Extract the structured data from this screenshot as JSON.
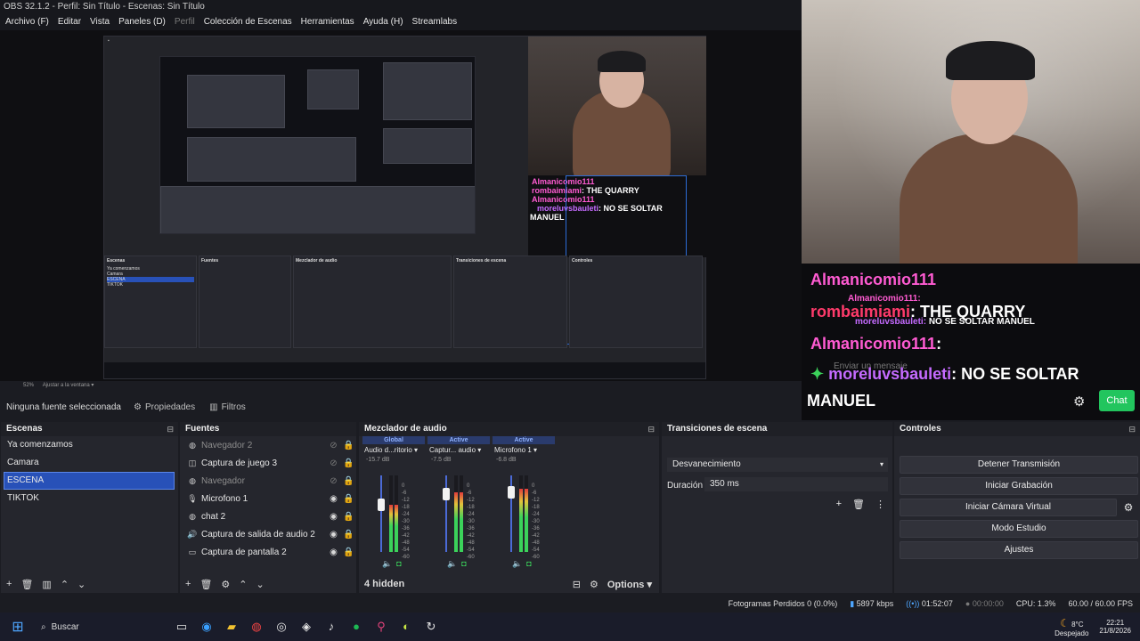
{
  "window": {
    "title": "OBS 32.1.2 - Perfil: Sin Título - Escenas: Sin Título"
  },
  "menu": [
    {
      "label": "Archivo (F)",
      "enabled": true
    },
    {
      "label": "Editar",
      "enabled": true
    },
    {
      "label": "Vista",
      "enabled": true
    },
    {
      "label": "Paneles (D)",
      "enabled": true
    },
    {
      "label": "Perfil",
      "enabled": false
    },
    {
      "label": "Colección de Escenas",
      "enabled": true
    },
    {
      "label": "Herramientas",
      "enabled": true
    },
    {
      "label": "Ayuda (H)",
      "enabled": true
    },
    {
      "label": "Streamlabs",
      "enabled": true
    }
  ],
  "chat_overlay": {
    "lines": [
      {
        "user": "Almanicomio111",
        "text": "",
        "user_color": "#ff5bd2"
      },
      {
        "user": "Almanicomio111:",
        "text": "",
        "user_color": "#ff5bd2"
      },
      {
        "user": "rombaimiami",
        "text": ": THE QUARRY",
        "user_color": "#ff3b6b"
      },
      {
        "user": "moreluvsbauleti:",
        "text": "NO SE SOLTAR MANUEL",
        "user_color": "#c56bff"
      },
      {
        "user": "Almanicomio111",
        "text": ":",
        "user_color": "#ff5bd2"
      },
      {
        "user": "moreluvsbauleti",
        "text": ": NO SE SOLTAR",
        "user_color": "#c56bff"
      }
    ],
    "manuel": "MANUEL",
    "input_placeholder": "Enviar un mensaje",
    "chat_button": "Chat"
  },
  "preview_strip": {
    "zoom": "52%",
    "fit": "Ajustar a la ventana"
  },
  "source_toolbar": {
    "message": "Ninguna fuente seleccionada",
    "properties": "Propiedades",
    "filters": "Filtros"
  },
  "scenes": {
    "title": "Escenas",
    "items": [
      {
        "label": "Ya comenzamos",
        "selected": false
      },
      {
        "label": "Camara",
        "selected": false
      },
      {
        "label": "ESCENA",
        "selected": true
      },
      {
        "label": "TIKTOK",
        "selected": false
      }
    ]
  },
  "sources": {
    "title": "Fuentes",
    "items": [
      {
        "label": "Navegador 2",
        "icon": "globe-icon",
        "visible": false,
        "muted": true
      },
      {
        "label": "Captura de juego 3",
        "icon": "gamepad-icon",
        "visible": false,
        "muted": false
      },
      {
        "label": "Navegador",
        "icon": "globe-icon",
        "visible": false,
        "muted": true
      },
      {
        "label": "Microfono 1",
        "icon": "mic-icon",
        "visible": true,
        "muted": false
      },
      {
        "label": "chat 2",
        "icon": "globe-icon",
        "visible": true,
        "muted": false
      },
      {
        "label": "Captura de salida de audio 2",
        "icon": "speaker-icon",
        "visible": true,
        "muted": false
      },
      {
        "label": "Captura de pantalla 2",
        "icon": "monitor-icon",
        "visible": true,
        "muted": false
      }
    ]
  },
  "mixer": {
    "title": "Mezclador de audio",
    "channels": [
      {
        "tag": "Global",
        "name": "Audio d...ritorio",
        "db": "-15.7 dB",
        "level": 0.62,
        "volume": 0.62
      },
      {
        "tag": "Active",
        "name": "Captur... audio",
        "db": "-7.5 dB",
        "level": 0.78,
        "volume": 0.76
      },
      {
        "tag": "Active",
        "name": "Microfono 1",
        "db": "-6.8 dB",
        "level": 0.82,
        "volume": 0.78
      }
    ],
    "scale": [
      "0",
      "-6",
      "-12",
      "-18",
      "-24",
      "-30",
      "-36",
      "-42",
      "-48",
      "-54",
      "-60"
    ],
    "hidden": "4 hidden",
    "options": "Options"
  },
  "transitions": {
    "title": "Transiciones de escena",
    "selected": "Desvanecimiento",
    "duration_label": "Duración",
    "duration_value": "350 ms"
  },
  "controls": {
    "title": "Controles",
    "buttons": [
      "Detener Transmisión",
      "Iniciar Grabación",
      "Iniciar Cámara Virtual",
      "Modo Estudio",
      "Ajustes"
    ]
  },
  "status": {
    "dropped": "Fotogramas Perdidos 0 (0.0%)",
    "bitrate": "5897 kbps",
    "stream_time": "01:52:07",
    "rec_time": "00:00:00",
    "cpu": "CPU: 1.3%",
    "fps": "60.00 / 60.00 FPS"
  },
  "taskbar": {
    "search": "Buscar",
    "weather_temp": "8°C",
    "weather_desc": "Despejado",
    "time": "22:21",
    "date": "21/8/2026"
  }
}
